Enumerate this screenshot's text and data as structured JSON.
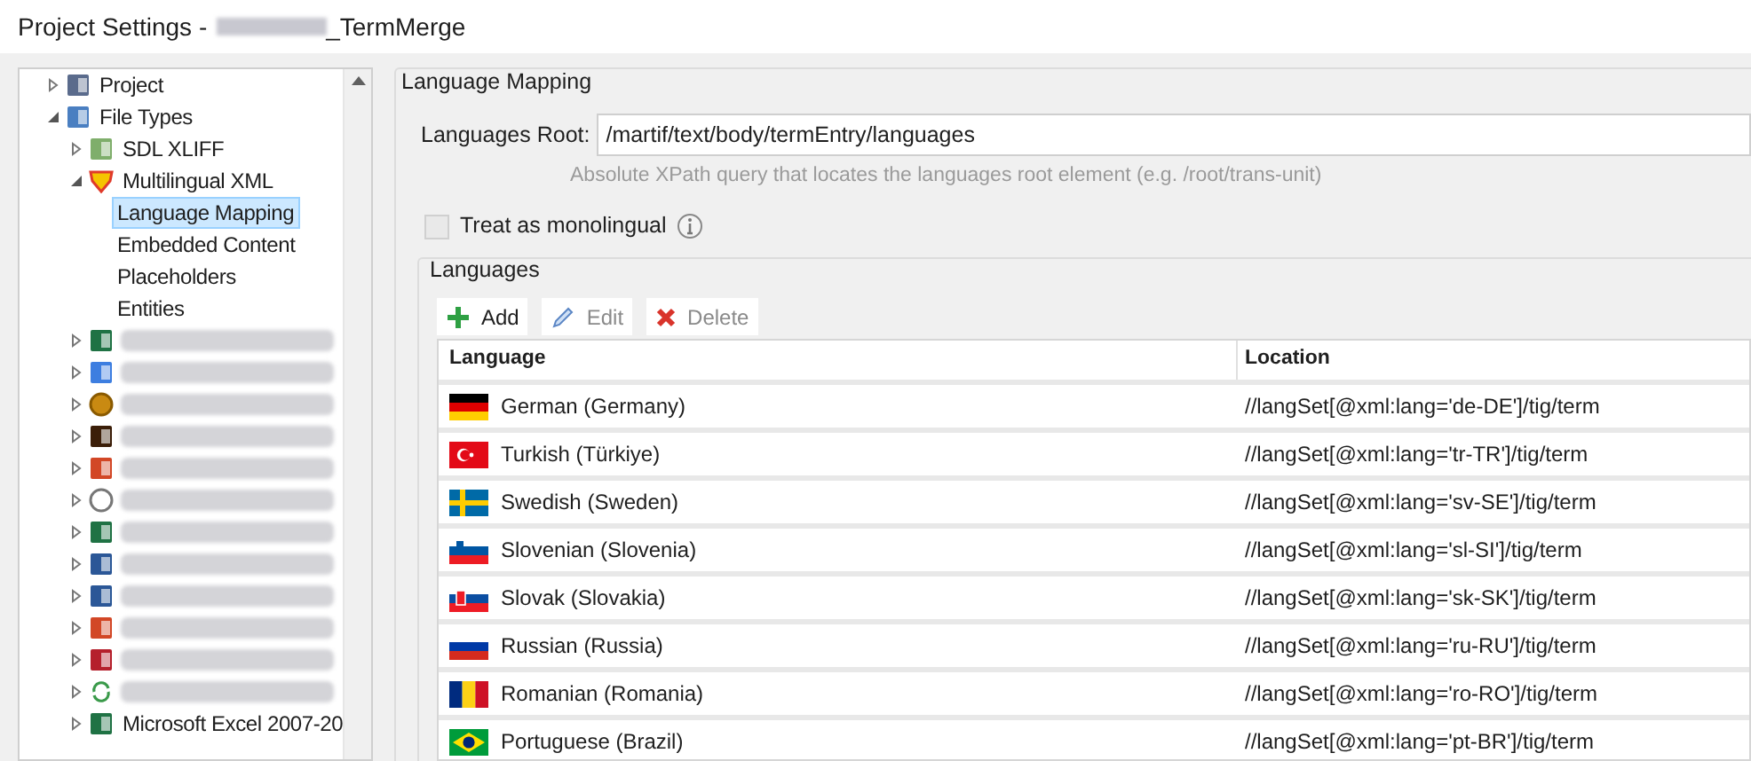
{
  "window": {
    "title_prefix": "Project Settings -",
    "title_suffix": "_TermMerge"
  },
  "tree": [
    {
      "kind": "item",
      "label": "Project",
      "expanded": false,
      "selected": false
    },
    {
      "kind": "item",
      "label": "File Types",
      "expanded": true,
      "selected": false,
      "children": [
        {
          "kind": "item",
          "label": "SDL XLIFF",
          "expanded": false,
          "selected": false
        },
        {
          "kind": "item",
          "label": "Multilingual XML",
          "expanded": true,
          "selected": false,
          "children": [
            {
              "kind": "item",
              "label": "Language Mapping",
              "selected": true
            },
            {
              "kind": "item",
              "label": "Embedded Content",
              "selected": false
            },
            {
              "kind": "item",
              "label": "Placeholders",
              "selected": false
            },
            {
              "kind": "item",
              "label": "Entities",
              "selected": false
            }
          ]
        },
        {
          "kind": "blurred",
          "expanded": false
        },
        {
          "kind": "blurred",
          "expanded": false
        },
        {
          "kind": "blurred",
          "expanded": false
        },
        {
          "kind": "blurred",
          "expanded": false
        },
        {
          "kind": "blurred",
          "expanded": false
        },
        {
          "kind": "blurred",
          "expanded": false
        },
        {
          "kind": "blurred",
          "expanded": false
        },
        {
          "kind": "blurred",
          "expanded": false
        },
        {
          "kind": "blurred",
          "expanded": false
        },
        {
          "kind": "blurred",
          "expanded": false
        },
        {
          "kind": "blurred",
          "expanded": false
        },
        {
          "kind": "blurred",
          "expanded": false
        },
        {
          "kind": "item",
          "label": "Microsoft Excel 2007-20",
          "expanded": false,
          "selected": false
        }
      ]
    }
  ],
  "section": {
    "title": "Language Mapping",
    "root_label": "Languages Root:",
    "root_value": "/martif/text/body/termEntry/languages",
    "root_hint": "Absolute XPath query that locates the languages root element (e.g. /root/trans-unit)",
    "monolingual": {
      "label": "Treat as monolingual",
      "checked": false
    }
  },
  "languages": {
    "title": "Languages",
    "toolbar": [
      {
        "kind": "add",
        "label": "Add",
        "disabled": false
      },
      {
        "kind": "edit",
        "label": "Edit",
        "disabled": true
      },
      {
        "kind": "delete",
        "label": "Delete",
        "disabled": true
      }
    ],
    "columns": [
      "Language",
      "Location"
    ],
    "rows": [
      {
        "language": "German (Germany)",
        "location": "//langSet[@xml:lang='de-DE']/tig/term"
      },
      {
        "language": "Turkish (Türkiye)",
        "location": "//langSet[@xml:lang='tr-TR']/tig/term"
      },
      {
        "language": "Swedish (Sweden)",
        "location": "//langSet[@xml:lang='sv-SE']/tig/term"
      },
      {
        "language": "Slovenian (Slovenia)",
        "location": "//langSet[@xml:lang='sl-SI']/tig/term"
      },
      {
        "language": "Slovak (Slovakia)",
        "location": "//langSet[@xml:lang='sk-SK']/tig/term"
      },
      {
        "language": "Russian (Russia)",
        "location": "//langSet[@xml:lang='ru-RU']/tig/term"
      },
      {
        "language": "Romanian (Romania)",
        "location": "//langSet[@xml:lang='ro-RO']/tig/term"
      },
      {
        "language": "Portuguese (Brazil)",
        "location": "//langSet[@xml:lang='pt-BR']/tig/term"
      }
    ]
  }
}
